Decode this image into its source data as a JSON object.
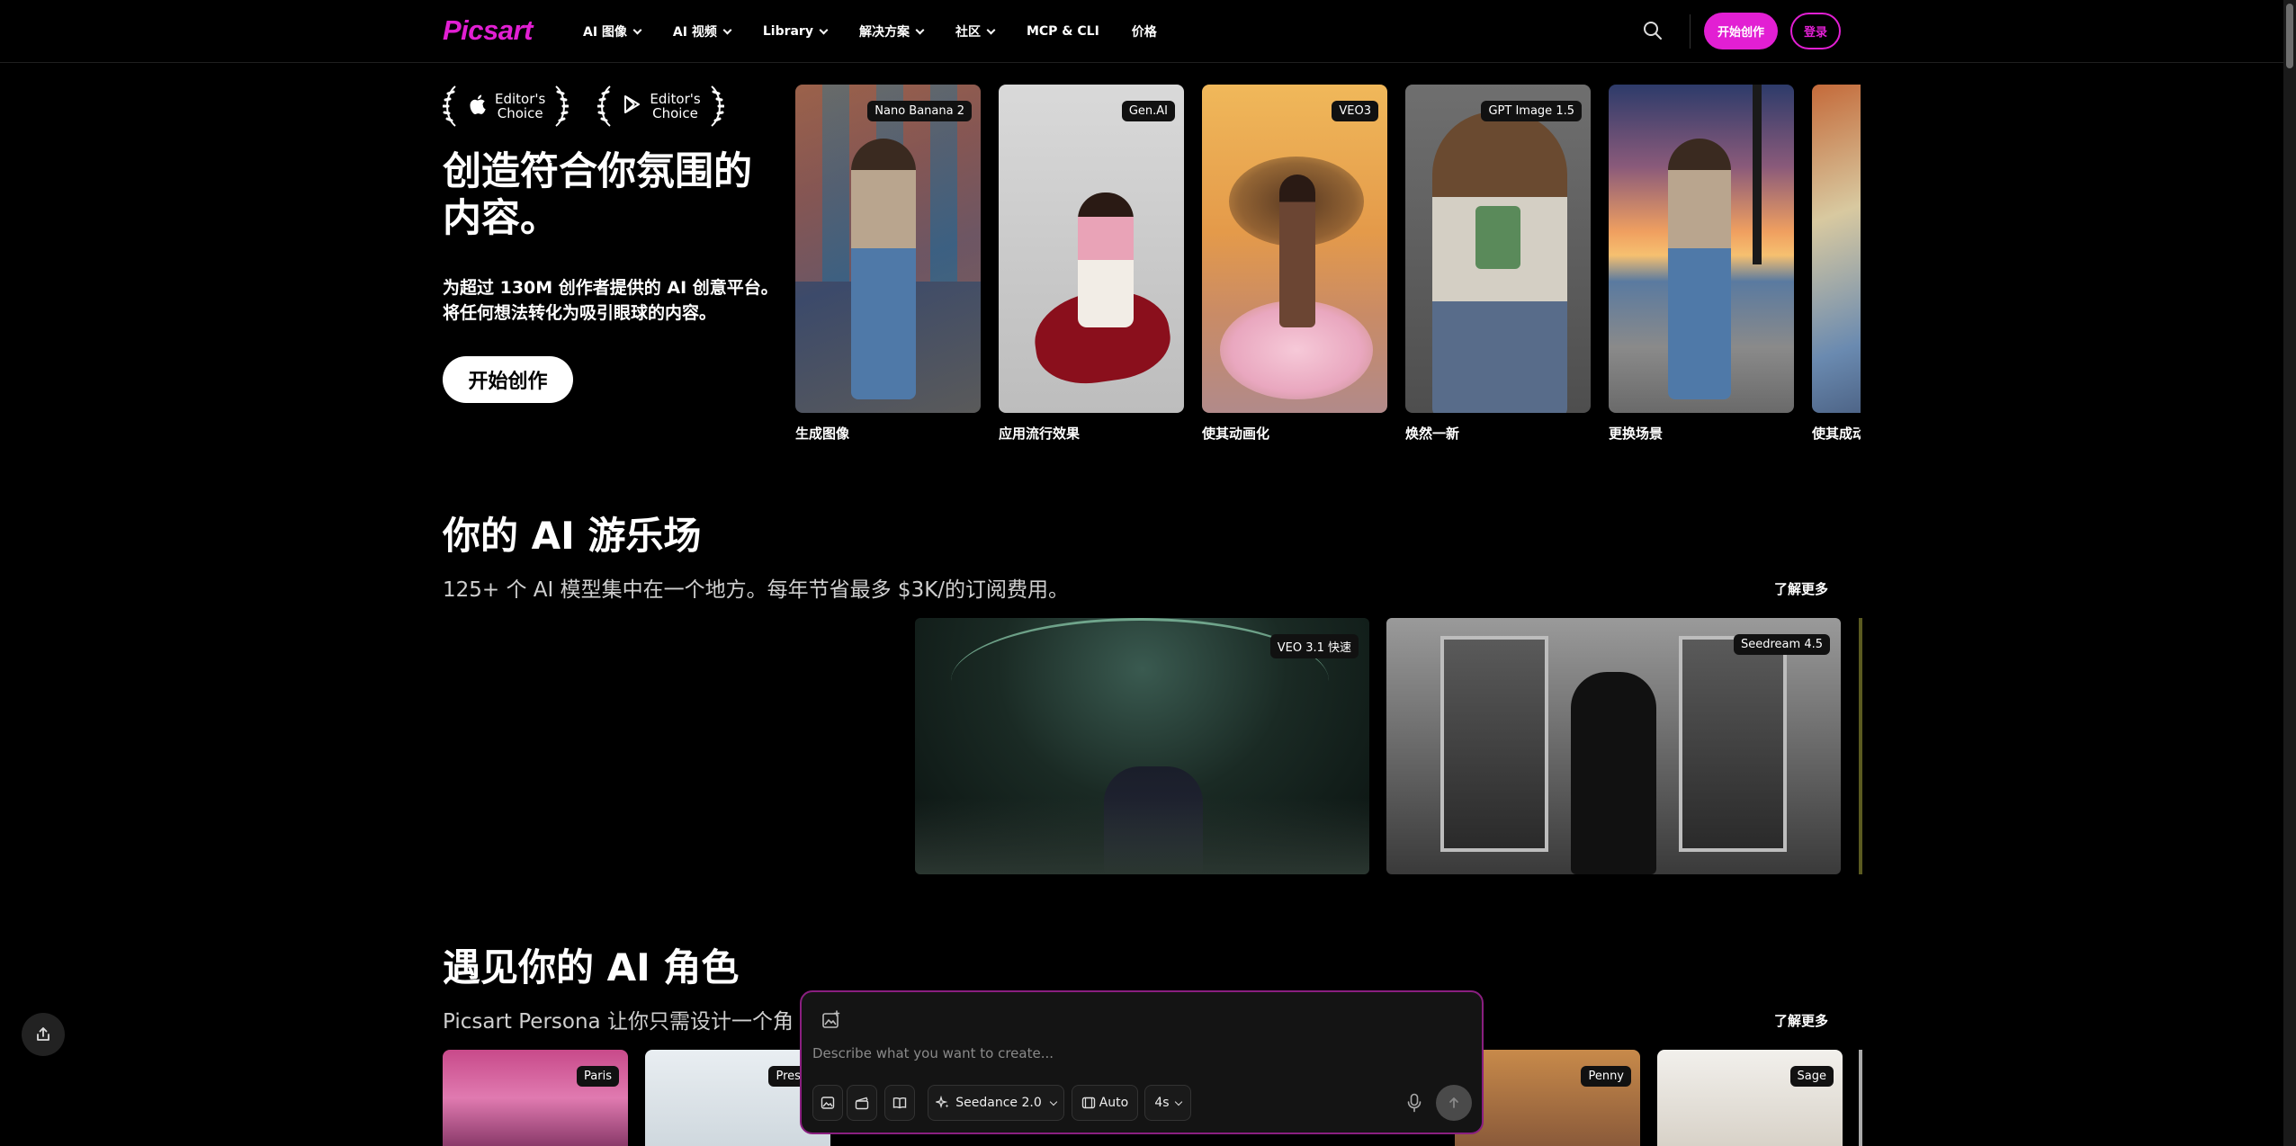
{
  "nav": {
    "logo": "Picsart",
    "items": [
      {
        "label": "AI 图像",
        "dropdown": true
      },
      {
        "label": "AI 视频",
        "dropdown": true
      },
      {
        "label": "Library",
        "dropdown": true
      },
      {
        "label": "解决方案",
        "dropdown": true
      },
      {
        "label": "社区",
        "dropdown": true
      },
      {
        "label": "MCP & CLI",
        "dropdown": false
      },
      {
        "label": "价格",
        "dropdown": false
      }
    ],
    "start_label": "开始创作",
    "login_label": "登录"
  },
  "hero": {
    "badges": [
      {
        "platform": "apple-icon",
        "line1": "Editor's",
        "line2": "Choice"
      },
      {
        "platform": "google-play-icon",
        "line1": "Editor's",
        "line2": "Choice"
      }
    ],
    "title": "创造符合你氛围的内容。",
    "subtitle_line1": "为超过 130M 创作者提供的 AI 创意平台。",
    "subtitle_line2": "将任何想法转化为吸引眼球的内容。",
    "cta": "开始创作",
    "cards": [
      {
        "tag": "Nano Banana 2",
        "caption": "生成图像"
      },
      {
        "tag": "Gen.AI",
        "caption": "应用流行效果"
      },
      {
        "tag": "VEO3",
        "caption": "使其动画化"
      },
      {
        "tag": "GPT Image 1.5",
        "caption": "焕然一新"
      },
      {
        "tag": "",
        "caption": "更换场景"
      },
      {
        "tag": "",
        "caption": "使其成动"
      }
    ]
  },
  "playground": {
    "title": "你的 AI 游乐场",
    "subtitle": "125+ 个 AI 模型集中在一个地方。每年节省最多 $3K/的订阅费用。",
    "learn_more": "了解更多",
    "videos": [
      {
        "tag": "VEO 3.1 快速"
      },
      {
        "tag": "Seedream 4.5"
      }
    ]
  },
  "persona": {
    "title": "遇见你的 AI 角色",
    "subtitle": "Picsart Persona 让你只需设计一个角",
    "learn_more": "了解更多",
    "cards": [
      {
        "tag": "Paris"
      },
      {
        "tag": "Presco"
      },
      {
        "tag": "Penny"
      },
      {
        "tag": "Sage"
      }
    ]
  },
  "prompt": {
    "placeholder": "Describe what you want to create...",
    "model": "Seedance 2.0",
    "ratio": "Auto",
    "duration": "4s"
  },
  "colors": {
    "brand": "#e21fd3",
    "background": "#000000"
  }
}
